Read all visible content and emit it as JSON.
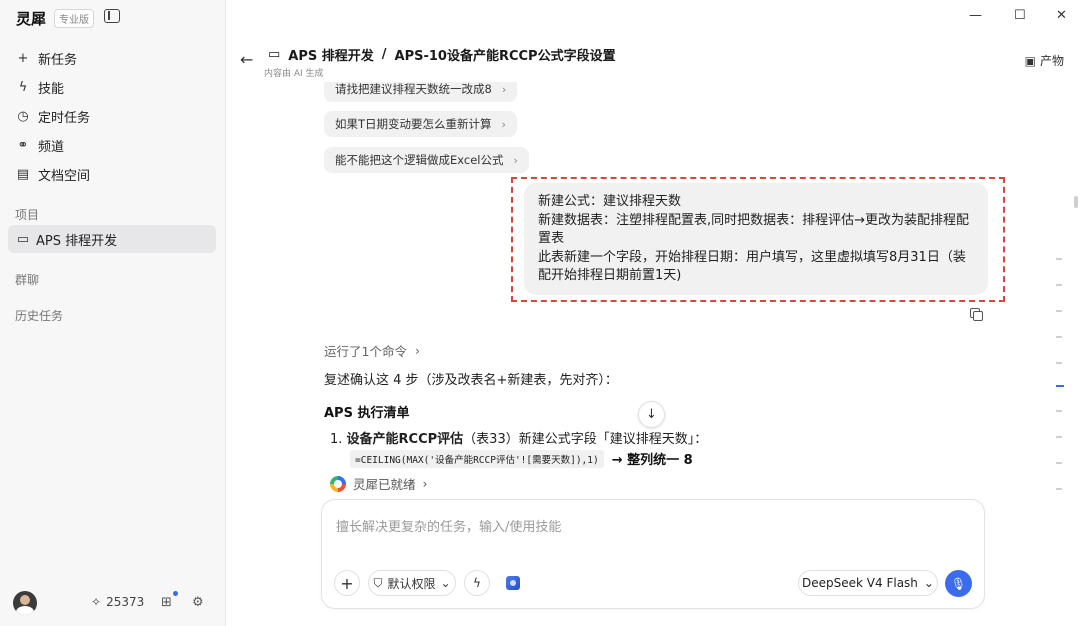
{
  "app": {
    "name": "灵犀",
    "badge": "专业版"
  },
  "window": {
    "minimize": "—",
    "maximize": "☐",
    "close": "✕"
  },
  "sidebar": {
    "nav": [
      {
        "icon": "+",
        "label": "新任务"
      },
      {
        "icon": "ϟ",
        "label": "技能"
      },
      {
        "icon": "◷",
        "label": "定时任务"
      },
      {
        "icon": "⚭",
        "label": "频道"
      },
      {
        "icon": "▤",
        "label": "文档空间"
      }
    ],
    "projects_label": "项目",
    "project": {
      "icon": "▭",
      "label": "APS 排程开发"
    },
    "groups_label": "群聊",
    "history_label": "历史任务",
    "footer": {
      "points_icon": "✧",
      "points": "25373",
      "gift_icon": "⊞",
      "settings_icon": "⚙"
    }
  },
  "header": {
    "back_icon": "←",
    "folder_icon": "▭",
    "project": "APS 排程开发",
    "separator": "/",
    "task": "APS-10设备产能RCCP公式字段设置",
    "subline": "内容由 AI 生成",
    "artifact_icon": "▣",
    "artifact_label": "产物"
  },
  "chat": {
    "suggestions": [
      {
        "label": "请找把建议排程天数统一改成8",
        "chev": "›"
      },
      {
        "label": "如果T日期变动要怎么重新计算",
        "chev": "›"
      },
      {
        "label": "能不能把这个逻辑做成Excel公式",
        "chev": "›"
      }
    ],
    "user_message": [
      "新建公式：建议排程天数",
      "新建数据表：注塑排程配置表,同时把数据表：排程评估→更改为装配排程配置表",
      "此表新建一个字段，开始排程日期：用户填写，这里虚拟填写8月31日（装配开始排程日期前置1天)"
    ],
    "ran_command": "运行了1个命令",
    "ran_chev": "›",
    "reply_intro": "复述确认这 4 步（涉及改表名+新建表，先对齐）：",
    "list_title": "APS 执行清单",
    "item1_index": "1.",
    "item1_bold": "设备产能RCCP评估",
    "item1_text": "（表33）新建公式字段「建议排程天数」：",
    "item1_code": "=CEILING(MAX('设备产能RCCP评估'![需要天数]),1)",
    "item1_tail": "→ 整列统一 8",
    "scroll_icon": "↓",
    "ready": "灵犀已就绪",
    "ready_chev": "›"
  },
  "composer": {
    "placeholder": "擅长解决更复杂的任务，输入/使用技能",
    "plus_icon": "+",
    "perm_icon": "⛉",
    "perm_label": "默认权限",
    "perm_chev": "⌄",
    "bolt_icon": "ϟ",
    "model": "DeepSeek V4 Flash",
    "model_chev": "⌄",
    "mic_icon": "🎙"
  }
}
